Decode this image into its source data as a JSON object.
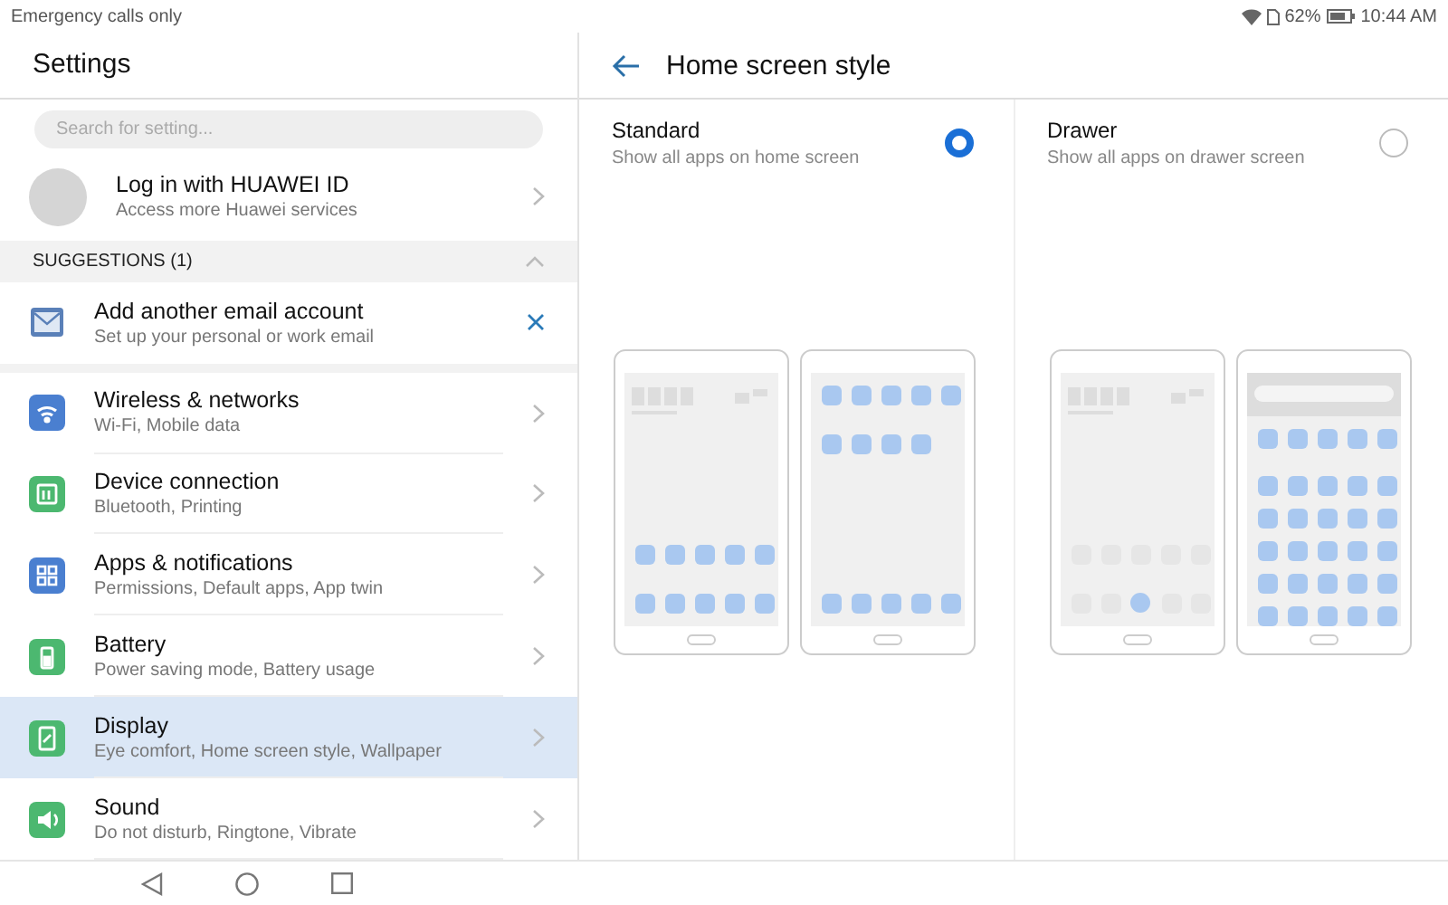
{
  "status_bar": {
    "carrier": "Emergency calls only",
    "battery": "62%",
    "time": "10:44 AM"
  },
  "settings": {
    "title": "Settings",
    "search": {
      "placeholder": "Search for setting..."
    },
    "account": {
      "title": "Log in with HUAWEI ID",
      "subtitle": "Access more Huawei services"
    },
    "suggestions": {
      "label": "SUGGESTIONS (1)",
      "expanded": true,
      "items": [
        {
          "title": "Add another email account",
          "subtitle": "Set up your personal or work email"
        }
      ]
    },
    "items": [
      {
        "kind": "wifi",
        "color": "#4a7fd0",
        "title": "Wireless & networks",
        "subtitle": "Wi-Fi, Mobile data",
        "selected": false
      },
      {
        "kind": "device",
        "color": "#4cb870",
        "title": "Device connection",
        "subtitle": "Bluetooth, Printing",
        "selected": false
      },
      {
        "kind": "apps",
        "color": "#4a7fd0",
        "title": "Apps & notifications",
        "subtitle": "Permissions, Default apps, App twin",
        "selected": false
      },
      {
        "kind": "battery",
        "color": "#4cb870",
        "title": "Battery",
        "subtitle": "Power saving mode, Battery usage",
        "selected": false
      },
      {
        "kind": "display",
        "color": "#4cb870",
        "title": "Display",
        "subtitle": "Eye comfort, Home screen style, Wallpaper",
        "selected": true
      },
      {
        "kind": "sound",
        "color": "#4cb870",
        "title": "Sound",
        "subtitle": "Do not disturb, Ringtone, Vibrate",
        "selected": false
      }
    ]
  },
  "detail": {
    "title": "Home screen style",
    "options": [
      {
        "kind": "standard",
        "title": "Standard",
        "subtitle": "Show all apps on home screen",
        "selected": true
      },
      {
        "kind": "drawer",
        "title": "Drawer",
        "subtitle": "Show all apps on drawer screen",
        "selected": false
      }
    ]
  }
}
